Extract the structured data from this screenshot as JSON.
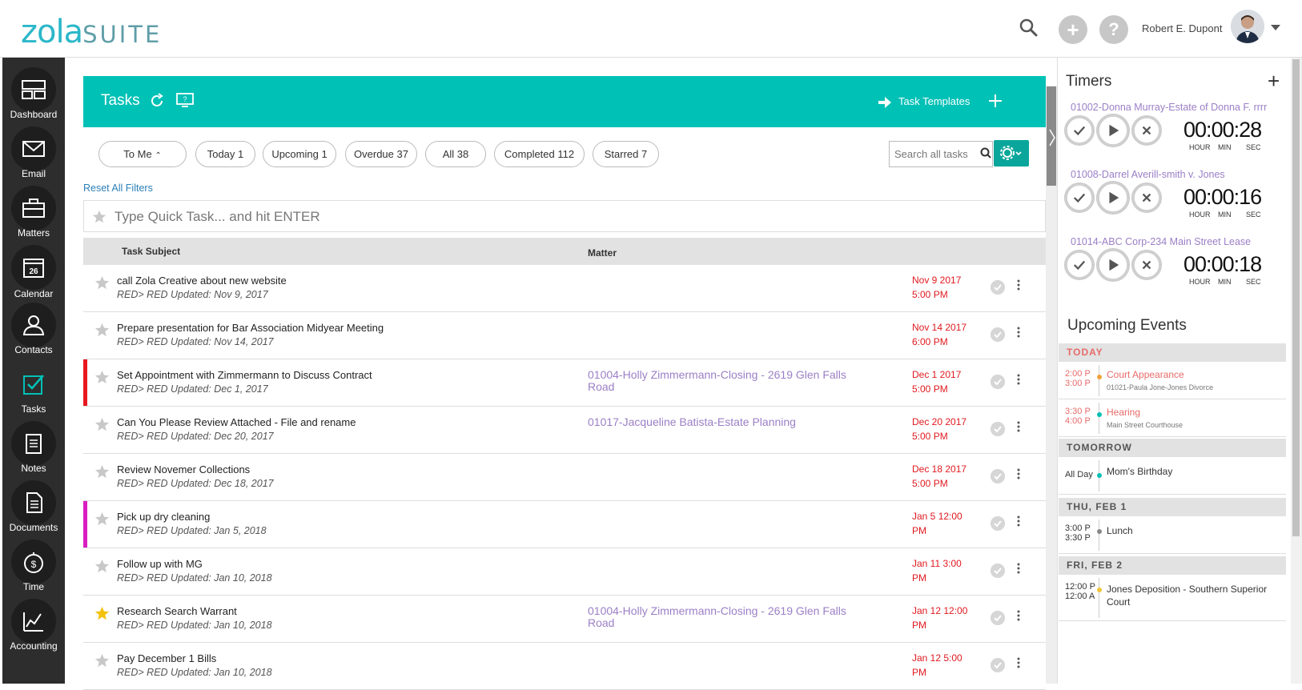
{
  "logo": {
    "zola": "zola",
    "suite": "SUITE"
  },
  "user": {
    "name": "Robert E. Dupont"
  },
  "header_buttons": {
    "add": "+",
    "help": "?"
  },
  "nav": [
    {
      "label": "Dashboard",
      "icon": "dashboard-icon"
    },
    {
      "label": "Email",
      "icon": "email-icon"
    },
    {
      "label": "Matters",
      "icon": "briefcase-icon"
    },
    {
      "label": "Calendar",
      "icon": "calendar-icon",
      "badge": "26"
    },
    {
      "label": "Contacts",
      "icon": "contacts-icon"
    },
    {
      "label": "Tasks",
      "icon": "tasks-icon"
    },
    {
      "label": "Notes",
      "icon": "notes-icon"
    },
    {
      "label": "Documents",
      "icon": "documents-icon"
    },
    {
      "label": "Time",
      "icon": "stopwatch-icon"
    },
    {
      "label": "Accounting",
      "icon": "chart-icon"
    }
  ],
  "tasks": {
    "title": "Tasks",
    "templates_label": "Task Templates",
    "filters": [
      "To Me",
      "Today 1",
      "Upcoming 1",
      "Overdue 37",
      "All 38",
      "Completed 112",
      "Starred 7"
    ],
    "search_placeholder": "Search all tasks",
    "reset_label": "Reset All Filters",
    "quick_task_placeholder": "Type Quick Task... and hit ENTER",
    "col_subject": "Task Subject",
    "col_matter": "Matter",
    "rows": [
      {
        "subject": "call Zola Creative about new website",
        "meta": "RED> RED   Updated: Nov 9, 2017",
        "matter": "",
        "due1": "Nov 9 2017",
        "due2": "5:00 PM",
        "flag": "",
        "starred": false
      },
      {
        "subject": "Prepare presentation for Bar Association Midyear Meeting",
        "meta": "RED> RED   Updated: Nov 14, 2017",
        "matter": "",
        "due1": "Nov 14 2017",
        "due2": "6:00 PM",
        "flag": "",
        "starred": false
      },
      {
        "subject": "Set Appointment with Zimmermann to Discuss Contract",
        "meta": "RED> RED   Updated: Dec 1, 2017",
        "matter": "01004-Holly Zimmermann-Closing - 2619 Glen Falls Road",
        "due1": "Dec 1 2017",
        "due2": "5:00 PM",
        "flag": "#e8181f",
        "starred": false
      },
      {
        "subject": "Can You Please Review Attached - File and rename",
        "meta": "RED> RED   Updated: Dec 20, 2017",
        "matter": "01017-Jacqueline Batista-Estate Planning",
        "due1": "Dec 20 2017",
        "due2": "5:00 PM",
        "flag": "",
        "starred": false
      },
      {
        "subject": "Review Novemer Collections",
        "meta": "RED> RED   Updated: Dec 18, 2017",
        "matter": "",
        "due1": "Dec 18 2017",
        "due2": "5:00 PM",
        "flag": "",
        "starred": false
      },
      {
        "subject": "Pick up dry cleaning",
        "meta": "RED> RED   Updated: Jan 5, 2018",
        "matter": "",
        "due1": "Jan 5 12:00",
        "due2": "PM",
        "flag": "#d81ec0",
        "starred": false
      },
      {
        "subject": "Follow up with MG",
        "meta": "RED> RED   Updated: Jan 10, 2018",
        "matter": "",
        "due1": "Jan 11 3:00",
        "due2": "PM",
        "flag": "",
        "starred": false
      },
      {
        "subject": "Research Search Warrant",
        "meta": "RED> RED   Updated: Jan 10, 2018",
        "matter": "01004-Holly Zimmermann-Closing - 2619 Glen Falls Road",
        "due1": "Jan 12 12:00",
        "due2": "PM",
        "flag": "",
        "starred": true
      },
      {
        "subject": "Pay December 1 Bills",
        "meta": "RED> RED   Updated: Jan 10, 2018",
        "matter": "",
        "due1": "Jan 12 5:00",
        "due2": "PM",
        "flag": "",
        "starred": false
      }
    ]
  },
  "timers": {
    "title": "Timers",
    "add": "+",
    "items": [
      {
        "name": "01002-Donna Murray-Estate of Donna F. rrrr",
        "hh": "00",
        "mm": "00",
        "ss": "28"
      },
      {
        "name": "01008-Darrel Averill-smith v. Jones",
        "hh": "00",
        "mm": "00",
        "ss": "16"
      },
      {
        "name": "01014-ABC Corp-234 Main Street Lease",
        "hh": "00",
        "mm": "00",
        "ss": "18"
      }
    ],
    "labels": {
      "hour": "HOUR",
      "min": "MIN",
      "sec": "SEC"
    }
  },
  "upcoming": {
    "title": "Upcoming Events",
    "groups": [
      {
        "label": "TODAY",
        "label_color": "#e86a6a",
        "events": [
          {
            "t1": "2:00 P",
            "t2": "3:00 P",
            "title": "Court Appearance",
            "sub": "01021-Paula Jone-Jones Divorce",
            "color": "#f0a23a",
            "title_color": "#e86a6a"
          },
          {
            "t1": "3:30 P",
            "t2": "4:00 P",
            "title": "Hearing",
            "sub": "Main Street Courthouse",
            "color": "#00bfb3",
            "title_color": "#e86a6a"
          }
        ]
      },
      {
        "label": "TOMORROW",
        "label_color": "#555555",
        "events": [
          {
            "t1": "All Day",
            "t2": "",
            "title": "Mom's Birthday",
            "sub": "",
            "color": "#00bfb3",
            "title_color": "#333333"
          }
        ]
      },
      {
        "label": "THU, FEB 1",
        "label_color": "#555555",
        "events": [
          {
            "t1": "3:00 P",
            "t2": "3:30 P",
            "title": "Lunch",
            "sub": "",
            "color": "#888888",
            "title_color": "#333333"
          }
        ]
      },
      {
        "label": "FRI, FEB 2",
        "label_color": "#555555",
        "events": [
          {
            "t1": "12:00 P",
            "t2": "12:00 A",
            "title": "Jones Deposition - Southern Superior Court",
            "sub": "",
            "color": "#f0c43a",
            "title_color": "#333333"
          }
        ]
      }
    ]
  },
  "colors": {
    "accent": "#00c1b6",
    "accent_dark": "#0aa69b",
    "link": "#9b7fc6",
    "due": "#e0191f",
    "sidebar": "#2d2d2d"
  }
}
